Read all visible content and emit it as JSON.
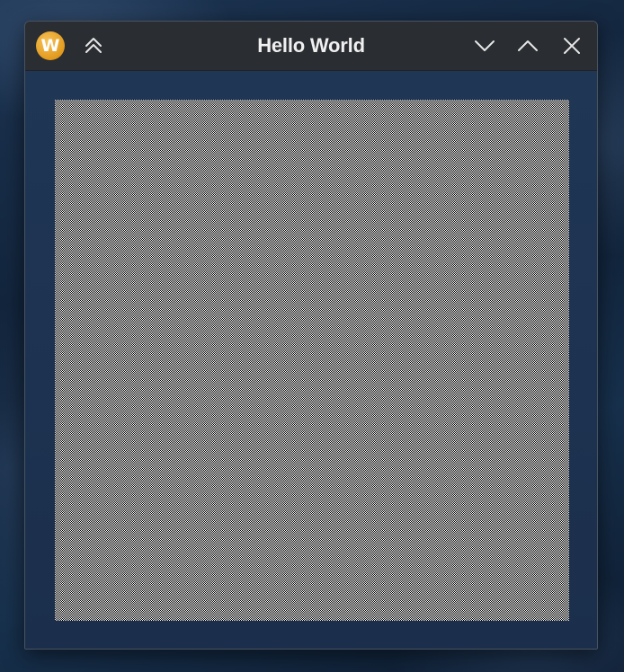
{
  "window": {
    "title": "Hello World",
    "app_icon_letter": "W"
  },
  "titlebar_buttons": {
    "shade": "chevron-double-up-icon",
    "minimize": "chevron-down-icon",
    "maximize": "chevron-up-icon",
    "close": "close-icon"
  },
  "colors": {
    "titlebar": "#2a2d31",
    "app_icon": "#e8a22a",
    "content_background": "#1d3250",
    "canvas_pattern_dark": "#000000",
    "canvas_pattern_light": "#ffffff"
  }
}
